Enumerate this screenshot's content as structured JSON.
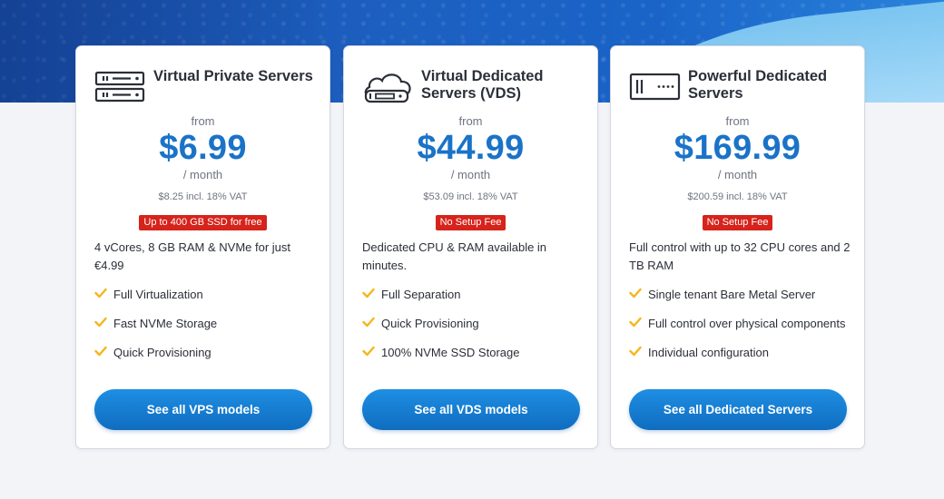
{
  "colors": {
    "price": "#1a73c8",
    "badge": "#d6231b",
    "check": "#f4b61a",
    "button": "#1a80d4"
  },
  "cards": [
    {
      "icon": "server-rack-icon",
      "title": "Virtual Private Servers",
      "from": "from",
      "price": "$6.99",
      "per": "/ month",
      "vat": "$8.25 incl. 18% VAT",
      "badge": "Up to 400 GB SSD for free",
      "description": "4 vCores, 8 GB RAM & NVMe for just €4.99",
      "features": [
        "Full Virtualization",
        "Fast NVMe Storage",
        "Quick Provisioning"
      ],
      "cta": "See all VPS models"
    },
    {
      "icon": "cloud-server-icon",
      "title": "Virtual Dedicated Servers (VDS)",
      "from": "from",
      "price": "$44.99",
      "per": "/ month",
      "vat": "$53.09 incl. 18% VAT",
      "badge": "No Setup Fee",
      "description": "Dedicated CPU & RAM available in minutes.",
      "features": [
        "Full Separation",
        "Quick Provisioning",
        "100% NVMe SSD Storage"
      ],
      "cta": "See all VDS models"
    },
    {
      "icon": "dedicated-server-icon",
      "title": "Powerful Dedicated Servers",
      "from": "from",
      "price": "$169.99",
      "per": "/ month",
      "vat": "$200.59 incl. 18% VAT",
      "badge": "No Setup Fee",
      "description": "Full control with up to 32 CPU cores and 2 TB RAM",
      "features": [
        "Single tenant Bare Metal Server",
        "Full control over physical components",
        "Individual configuration"
      ],
      "cta": "See all Dedicated Servers"
    }
  ]
}
